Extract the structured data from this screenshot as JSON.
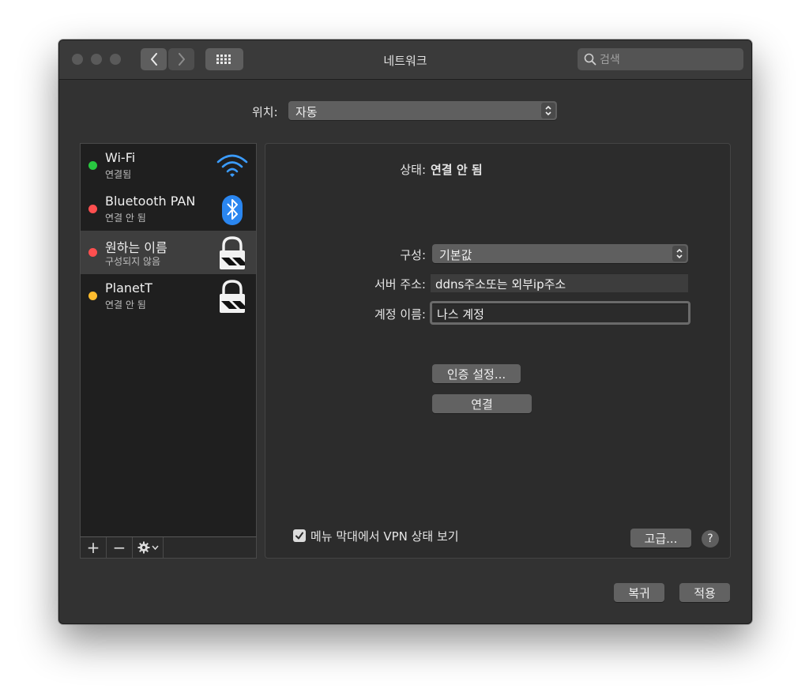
{
  "window": {
    "title": "네트워크"
  },
  "search": {
    "placeholder": "검색"
  },
  "location": {
    "label": "위치:",
    "value": "자동"
  },
  "services": [
    {
      "name": "Wi-Fi",
      "status": "연결됨",
      "status_color": "#28c840",
      "icon": "wifi-icon"
    },
    {
      "name": "Bluetooth PAN",
      "status": "연결 안 됨",
      "status_color": "#ff4f4f",
      "icon": "bluetooth-icon"
    },
    {
      "name": "원하는 이름",
      "status": "구성되지 않음",
      "status_color": "#ff4f4f",
      "icon": "lock-icon",
      "selected": true
    },
    {
      "name": "PlanetT",
      "status": "연결 안 됨",
      "status_color": "#febc2e",
      "icon": "lock-icon"
    }
  ],
  "sidebar_buttons": {
    "add": "+",
    "remove": "−"
  },
  "detail": {
    "status_label": "상태:",
    "status_value": "연결 안 됨",
    "config_label": "구성:",
    "config_value": "기본값",
    "server_label": "서버 주소:",
    "server_value": "ddns주소또는 외부ip주소",
    "account_label": "계정 이름:",
    "account_value": "나스 계정",
    "auth_button": "인증 설정...",
    "connect_button": "연결",
    "show_vpn_label": "메뉴 막대에서 VPN 상태 보기",
    "advanced_button": "고급...",
    "help": "?"
  },
  "footer": {
    "revert": "복귀",
    "apply": "적용"
  }
}
